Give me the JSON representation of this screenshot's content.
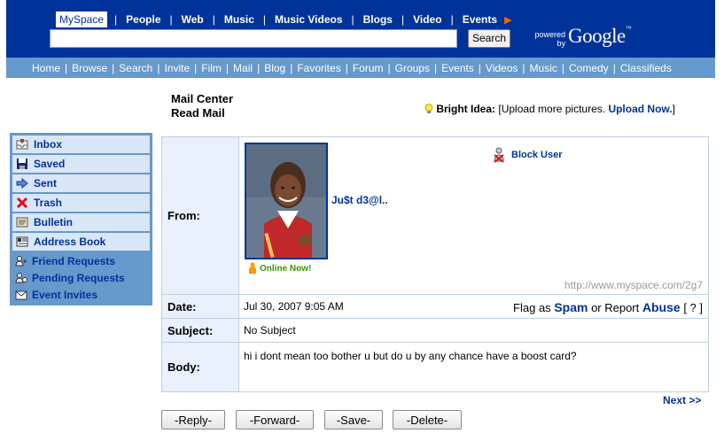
{
  "header": {
    "search_tabs": [
      "MySpace",
      "People",
      "Web",
      "Music",
      "Music Videos",
      "Blogs",
      "Video",
      "Events"
    ],
    "search_value": "",
    "search_button": "Search",
    "powered_by": "powered by",
    "google_logo": "Google"
  },
  "nav": {
    "items": [
      "Home",
      "Browse",
      "Search",
      "Invite",
      "Film",
      "Mail",
      "Blog",
      "Favorites",
      "Forum",
      "Groups",
      "Events",
      "Videos",
      "Music",
      "Comedy",
      "Classifieds"
    ]
  },
  "mail_header": {
    "title1": "Mail Center",
    "title2": "Read Mail",
    "idea_label": "Bright Idea:",
    "idea_text": "[Upload more pictures.",
    "idea_link": "Upload Now.",
    "idea_close": "]"
  },
  "sidebar": {
    "items": [
      {
        "label": "Inbox",
        "icon": "inbox-icon"
      },
      {
        "label": "Saved",
        "icon": "floppy-disk-icon"
      },
      {
        "label": "Sent",
        "icon": "arrow-right-icon"
      },
      {
        "label": "Trash",
        "icon": "red-x-icon"
      },
      {
        "label": "Bulletin",
        "icon": "bulletin-icon"
      },
      {
        "label": "Address Book",
        "icon": "address-book-icon"
      }
    ],
    "sub_items": [
      {
        "label": "Friend Requests",
        "icon": "friend-requests-icon"
      },
      {
        "label": "Pending Requests",
        "icon": "pending-requests-icon"
      },
      {
        "label": "Event Invites",
        "icon": "event-invites-icon"
      }
    ]
  },
  "message": {
    "from_label": "From:",
    "sender_name": "Ju$t d3@l..",
    "online_status": "Online Now!",
    "block_user": "Block User",
    "profile_url": "http://www.myspace.com/2g7",
    "date_label": "Date:",
    "date_value": "Jul 30, 2007 9:05 AM",
    "flag_prefix": "Flag as",
    "flag_spam": "Spam",
    "flag_or": "or Report",
    "flag_abuse": "Abuse",
    "flag_help": "[ ? ]",
    "subject_label": "Subject:",
    "subject_value": "No Subject",
    "body_label": "Body:",
    "body_value": "hi i dont mean too bother u but do u by any chance have a boost card?"
  },
  "pagination": {
    "next": "Next >>"
  },
  "actions": {
    "reply": "-Reply-",
    "forward": "-Forward-",
    "save": "-Save-",
    "delete": "-Delete-"
  },
  "colors": {
    "header_blue": "#003399",
    "nav_blue": "#6699cc",
    "link_blue": "#003399",
    "online_green": "#339900",
    "label_bg": "#e8f0fb"
  }
}
